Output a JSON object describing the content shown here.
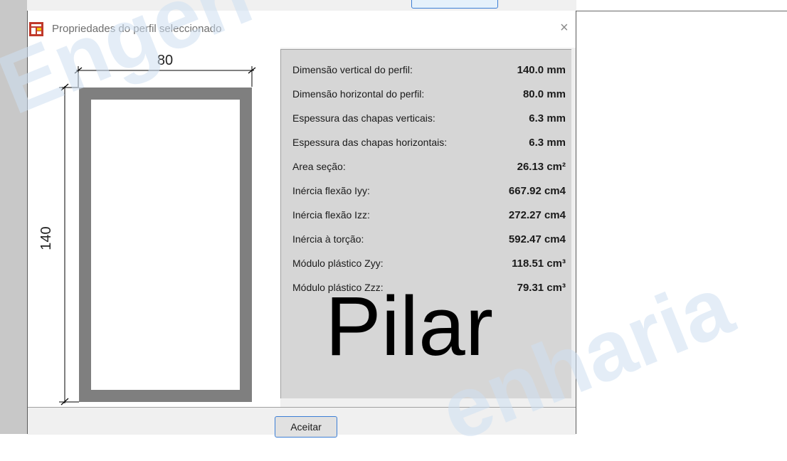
{
  "dialog": {
    "title": "Propriedades do perfil seleccionado",
    "close_glyph": "×",
    "accept_label": "Aceitar"
  },
  "drawing": {
    "width_label": "80",
    "height_label": "140"
  },
  "properties": [
    {
      "label": "Dimensão vertical do perfil:",
      "value": "140.0 mm"
    },
    {
      "label": "Dimensão horizontal do perfil:",
      "value": "80.0 mm"
    },
    {
      "label": "Espessura das chapas verticais:",
      "value": "6.3 mm"
    },
    {
      "label": "Espessura das chapas horizontais:",
      "value": "6.3 mm"
    },
    {
      "label": "Area seção:",
      "value": "26.13 cm²"
    },
    {
      "label": "Inércia flexão Iyy:",
      "value": "667.92 cm4"
    },
    {
      "label": "Inércia flexão Izz:",
      "value": "272.27 cm4"
    },
    {
      "label": "Inércia à torção:",
      "value": "592.47 cm4"
    },
    {
      "label": "Módulo plástico Zyy:",
      "value": "118.51 cm³"
    },
    {
      "label": "Módulo plástico Zzz:",
      "value": "79.31 cm³"
    }
  ],
  "element_type": "Pilar",
  "watermark": {
    "text_top": "Engen",
    "text_bottom": "enharia"
  },
  "colors": {
    "profile_fill": "#7f7f7f",
    "panel_bg": "#d6d6d6",
    "accent_border": "#3c7fd6"
  }
}
